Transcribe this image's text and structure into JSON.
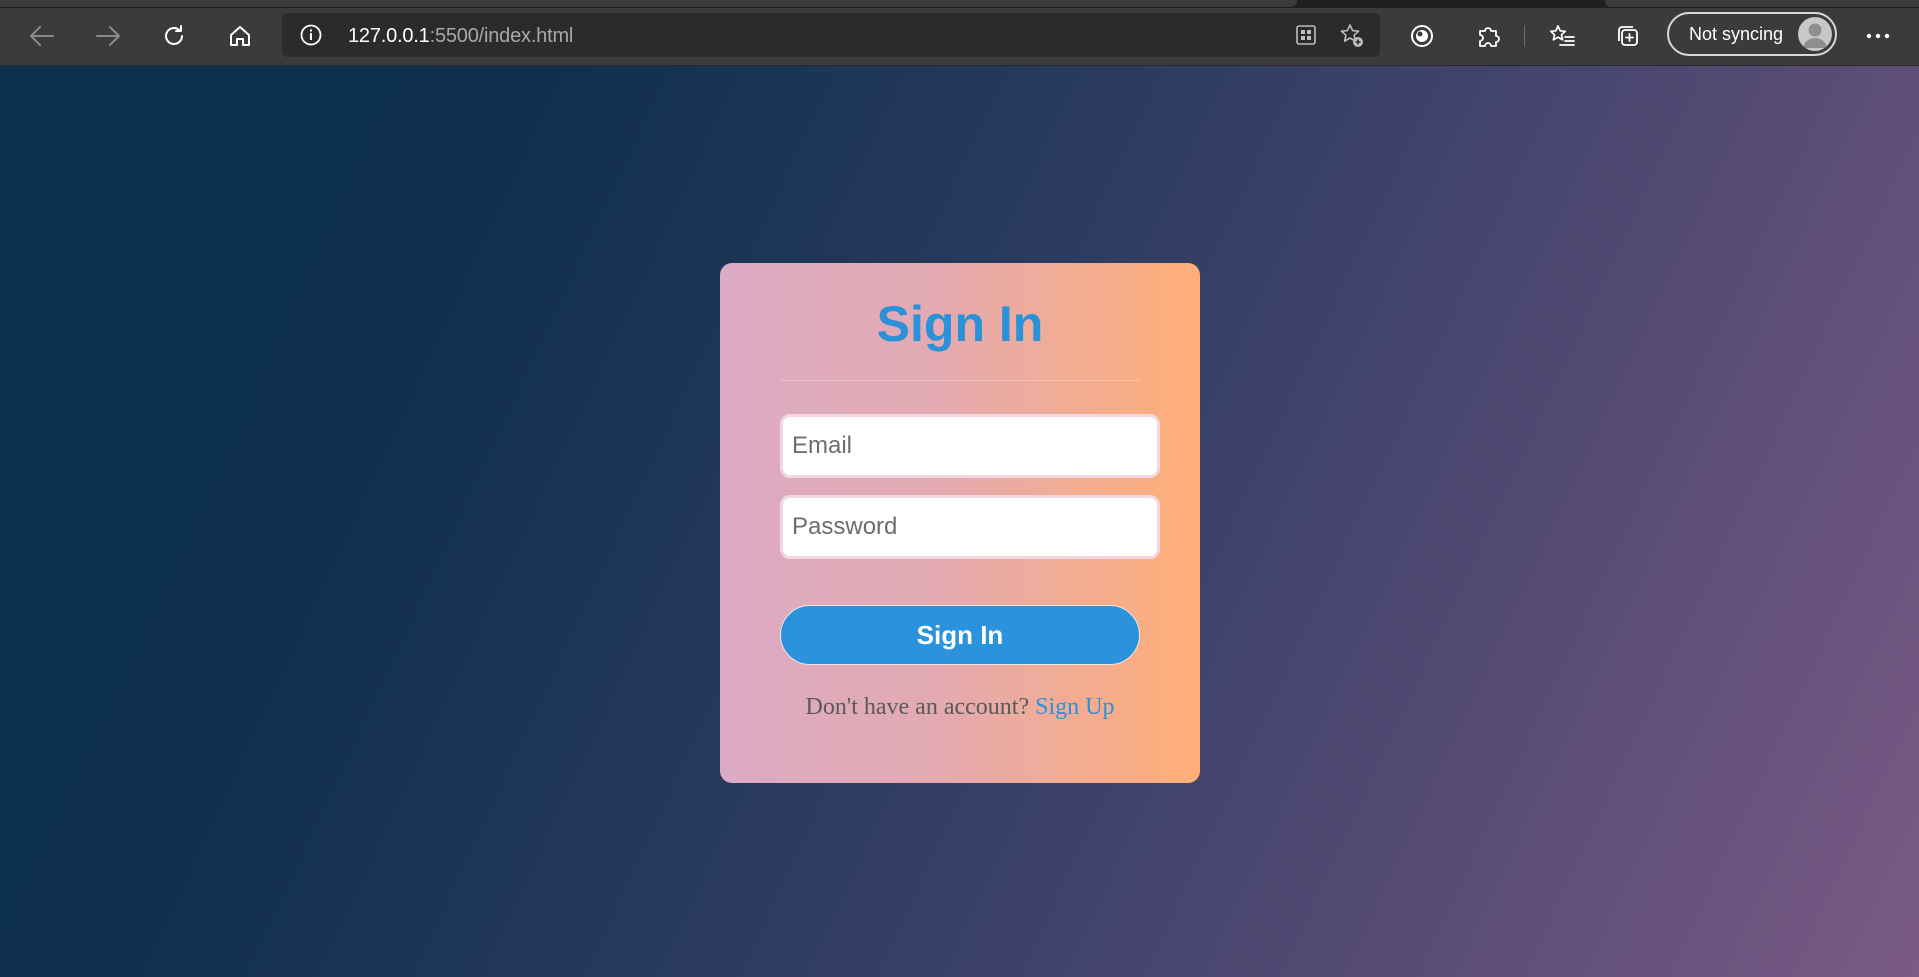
{
  "browser": {
    "url_host": "127.0.0.1",
    "url_path": ":5500/index.html",
    "profile_label": "Not syncing",
    "icons": {
      "back": "arrow-left-icon",
      "forward": "arrow-right-icon",
      "refresh": "refresh-icon",
      "home": "home-icon",
      "site_info": "info-icon",
      "app_available": "app-grid-icon",
      "add_favorite": "star-plus-icon",
      "browser_essentials": "essentials-icon",
      "extensions": "puzzle-icon",
      "favorites": "favorites-list-icon",
      "collections": "collections-icon",
      "menu": "ellipsis-icon"
    }
  },
  "page": {
    "title": "Sign In",
    "email_placeholder": "Email",
    "password_placeholder": "Password",
    "submit_label": "Sign In",
    "signup_prompt": "Don't have an account?",
    "signup_link": "Sign Up"
  },
  "colors": {
    "accent": "#2b91d8",
    "button": "#2a93dc",
    "card_gradient_start": "#dbaac4",
    "card_gradient_end": "#ffae76",
    "background_start": "#0c314d",
    "background_end": "#7a5a86"
  }
}
